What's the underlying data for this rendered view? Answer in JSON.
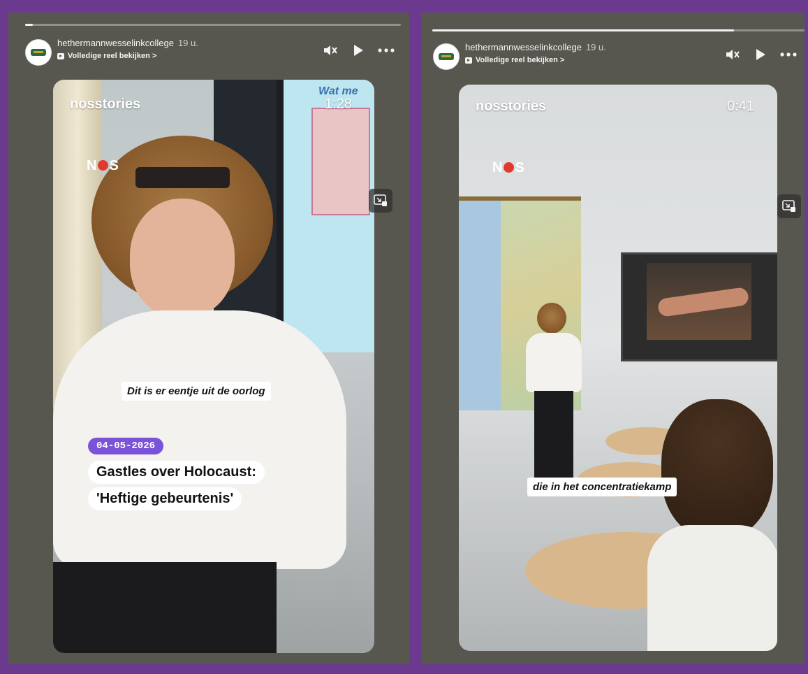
{
  "stories": [
    {
      "account": "hethermannwesselinkcollege",
      "time": "19 u.",
      "reel_link": "Volledige reel bekijken >",
      "progress": 0.02,
      "video": {
        "brand": "nosstories",
        "timer": "1:28",
        "logo": {
          "n": "N",
          "s": "S"
        },
        "board_partial_text": "Wat me",
        "caption": "Dit is er eentje uit de oorlog",
        "date": "04-05-2026",
        "headline_1": "Gastles over Holocaust:",
        "headline_2": "'Heftige gebeurtenis'"
      }
    },
    {
      "account": "hethermannwesselinkcollege",
      "time": "19 u.",
      "reel_link": "Volledige reel bekijken >",
      "progress": 0.81,
      "video": {
        "brand": "nosstories",
        "timer": "0:41",
        "logo": {
          "n": "N",
          "s": "S"
        },
        "caption": "die in het concentratiekamp"
      }
    }
  ],
  "icons": [
    "mute-icon",
    "play-icon",
    "more-icon",
    "pip-icon",
    "reel-icon"
  ],
  "colors": {
    "background": "#6b3a8e",
    "frame": "#57564f",
    "date_pill": "#7b53d9",
    "nos_red": "#e03a2f"
  }
}
